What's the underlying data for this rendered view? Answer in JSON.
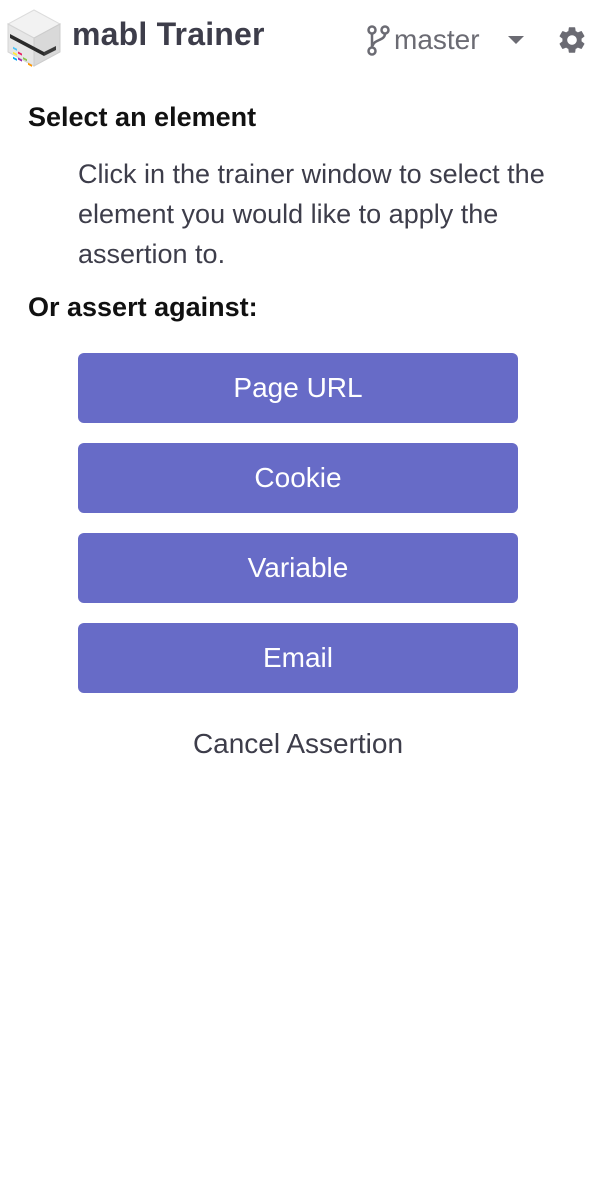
{
  "header": {
    "app_title": "mabl Trainer",
    "branch_name": "master",
    "icons": {
      "logo": "mabl-logo-icon",
      "branch": "git-branch-icon",
      "dropdown": "caret-down-icon",
      "settings": "gear-icon"
    }
  },
  "select_section": {
    "title": "Select an element",
    "instructions": "Click in the trainer window to select the element you would like to apply the assertion to."
  },
  "assert_section": {
    "title": "Or assert against:",
    "buttons": [
      {
        "label": "Page URL"
      },
      {
        "label": "Cookie"
      },
      {
        "label": "Variable"
      },
      {
        "label": "Email"
      }
    ]
  },
  "cancel_label": "Cancel Assertion",
  "colors": {
    "primary_button": "#676bc7",
    "text_dark": "#3d3d4a",
    "muted": "#6b6b73"
  }
}
